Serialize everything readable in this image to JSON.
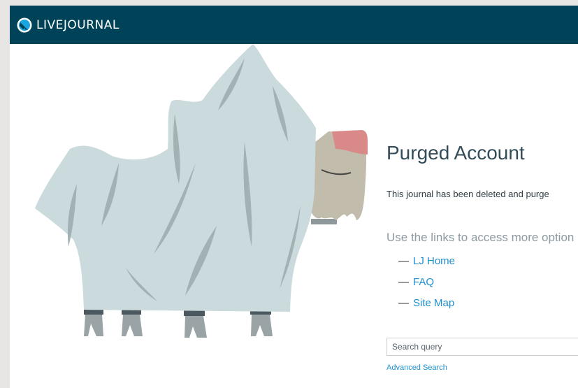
{
  "header": {
    "logo_text": "LIVEJOURNAL",
    "logo_icon": "livejournal-logo-icon"
  },
  "main": {
    "illustration": "ghost-sheet-creature",
    "title": "Purged Account",
    "description": "This journal has been deleted and purge",
    "options_heading": "Use the links to access more option",
    "links": [
      {
        "dash": "—",
        "label": "LJ Home"
      },
      {
        "dash": "—",
        "label": "FAQ"
      },
      {
        "dash": "—",
        "label": "Site Map"
      }
    ]
  },
  "search": {
    "placeholder": "Search query",
    "advanced_label": "Advanced Search"
  },
  "colors": {
    "header_bg": "#004359",
    "link": "#1e8fcf",
    "title": "#334c59"
  }
}
